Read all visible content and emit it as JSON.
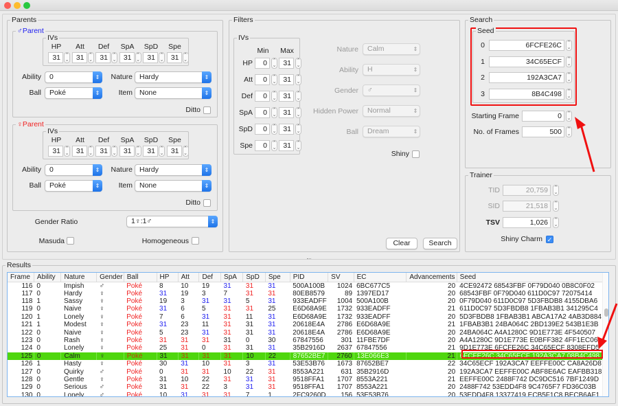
{
  "window": {
    "controls": [
      "close",
      "minimize",
      "maximize"
    ]
  },
  "parents": {
    "title": "Parents",
    "iv_group_label": "IVs",
    "iv_headers": [
      "HP",
      "Att",
      "Def",
      "SpA",
      "SpD",
      "Spe"
    ],
    "male": {
      "title": "♂Parent",
      "ivs": [
        "31",
        "31",
        "31",
        "31",
        "31",
        "31"
      ],
      "ability_label": "Ability",
      "ability": "0",
      "nature_label": "Nature",
      "nature": "Hardy",
      "ball_label": "Ball",
      "ball": "Poké",
      "item_label": "Item",
      "item": "None",
      "ditto_label": "Ditto",
      "ditto": false
    },
    "female": {
      "title": "♀Parent",
      "ivs": [
        "31",
        "31",
        "31",
        "31",
        "31",
        "31"
      ],
      "ability_label": "Ability",
      "ability": "0",
      "nature_label": "Nature",
      "nature": "Hardy",
      "ball_label": "Ball",
      "ball": "Poké",
      "item_label": "Item",
      "item": "None",
      "ditto_label": "Ditto",
      "ditto": false
    },
    "gender_ratio_label": "Gender Ratio",
    "gender_ratio": "1♀:1♂",
    "masuda_label": "Masuda",
    "masuda": false,
    "homogeneous_label": "Homogeneous",
    "homogeneous": false
  },
  "filters": {
    "title": "Filters",
    "ivs_title": "IVs",
    "min_label": "Min",
    "max_label": "Max",
    "iv_rows": [
      {
        "stat": "HP",
        "min": "0",
        "max": "31"
      },
      {
        "stat": "Att",
        "min": "0",
        "max": "31"
      },
      {
        "stat": "Def",
        "min": "0",
        "max": "31"
      },
      {
        "stat": "SpA",
        "min": "0",
        "max": "31"
      },
      {
        "stat": "SpD",
        "min": "0",
        "max": "31"
      },
      {
        "stat": "Spe",
        "min": "0",
        "max": "31"
      }
    ],
    "nature_label": "Nature",
    "nature": "Calm",
    "ability_label": "Ability",
    "ability": "H",
    "gender_label": "Gender",
    "gender": "♂",
    "hidden_power_label": "Hidden Power",
    "hidden_power": "Normal",
    "ball_label": "Ball",
    "ball": "Dream",
    "shiny_label": "Shiny",
    "shiny": false,
    "clear_label": "Clear",
    "search_label": "Search"
  },
  "search": {
    "title": "Search",
    "seed_title": "Seed",
    "seeds": [
      {
        "index": "0",
        "value": "6FCFE26C"
      },
      {
        "index": "1",
        "value": "34C65ECF"
      },
      {
        "index": "2",
        "value": "192A3CA7"
      },
      {
        "index": "3",
        "value": "8B4C498"
      }
    ],
    "starting_frame_label": "Starting Frame",
    "starting_frame": "0",
    "frames_label": "No. of Frames",
    "frames": "500"
  },
  "trainer": {
    "title": "Trainer",
    "tid_label": "TID",
    "tid": "20,759",
    "sid_label": "SID",
    "sid": "21,518",
    "tsv_label": "TSV",
    "tsv": "1,026",
    "shiny_charm_label": "Shiny Charm",
    "shiny_charm": true
  },
  "annotation": {
    "highlight_color": "#ff0000"
  },
  "results": {
    "title": "Results",
    "columns": [
      "Frame",
      "Ability",
      "Nature",
      "Gender",
      "Ball",
      "HP",
      "Att",
      "Def",
      "SpA",
      "SpD",
      "Spe",
      "PID",
      "SV",
      "EC",
      "Advancements",
      "Seed"
    ],
    "iv_colors": {
      "31_red": "#f02020",
      "31_blue": "#2020f0"
    },
    "selected_row_index": 9,
    "rows": [
      {
        "frame": "116",
        "ability": "0",
        "nature": "Impish",
        "gender": "♂",
        "ball": "Poké",
        "ivs": [
          [
            "8",
            ""
          ],
          [
            "10",
            ""
          ],
          [
            "19",
            ""
          ],
          [
            "31",
            "blue"
          ],
          [
            "31",
            "red"
          ],
          [
            "31",
            "blue"
          ]
        ],
        "pid": "500A100B",
        "sv": "1024",
        "ec": "6BC677C5",
        "adv": "20",
        "seed": "4CE92472 68543FBF 0F79D040 0B8C0F02"
      },
      {
        "frame": "117",
        "ability": "0",
        "nature": "Hardy",
        "gender": "♀",
        "ball": "Poké",
        "ivs": [
          [
            "31",
            "blue"
          ],
          [
            "19",
            ""
          ],
          [
            "3",
            ""
          ],
          [
            "7",
            ""
          ],
          [
            "31",
            "red"
          ],
          [
            "31",
            "red"
          ]
        ],
        "pid": "80EB8579",
        "sv": "89",
        "ec": "1397ED17",
        "adv": "20",
        "seed": "68543FBF 0F79D040 611D0C97 72075414"
      },
      {
        "frame": "118",
        "ability": "1",
        "nature": "Sassy",
        "gender": "♀",
        "ball": "Poké",
        "ivs": [
          [
            "19",
            ""
          ],
          [
            "3",
            ""
          ],
          [
            "31",
            "blue"
          ],
          [
            "31",
            "blue"
          ],
          [
            "5",
            ""
          ],
          [
            "31",
            "blue"
          ]
        ],
        "pid": "933EADFF",
        "sv": "1004",
        "ec": "500A100B",
        "adv": "20",
        "seed": "0F79D040 611D0C97 5D3FBDB8 4155DBA6"
      },
      {
        "frame": "119",
        "ability": "0",
        "nature": "Naive",
        "gender": "♀",
        "ball": "Poké",
        "ivs": [
          [
            "31",
            "blue"
          ],
          [
            "6",
            ""
          ],
          [
            "5",
            ""
          ],
          [
            "31",
            "red"
          ],
          [
            "31",
            "red"
          ],
          [
            "25",
            ""
          ]
        ],
        "pid": "E6D68A9E",
        "sv": "1732",
        "ec": "933EADFF",
        "adv": "21",
        "seed": "611D0C97 5D3FBDB8 1FBAB3B1 341295C4"
      },
      {
        "frame": "120",
        "ability": "1",
        "nature": "Lonely",
        "gender": "♀",
        "ball": "Poké",
        "ivs": [
          [
            "7",
            ""
          ],
          [
            "6",
            ""
          ],
          [
            "31",
            "blue"
          ],
          [
            "31",
            "red"
          ],
          [
            "11",
            ""
          ],
          [
            "31",
            "blue"
          ]
        ],
        "pid": "E6D68A9E",
        "sv": "1732",
        "ec": "933EADFF",
        "adv": "20",
        "seed": "5D3FBDB8 1FBAB3B1 ABCA17A2 4AB3D884"
      },
      {
        "frame": "121",
        "ability": "1",
        "nature": "Modest",
        "gender": "♀",
        "ball": "Poké",
        "ivs": [
          [
            "31",
            "blue"
          ],
          [
            "23",
            ""
          ],
          [
            "11",
            ""
          ],
          [
            "31",
            "red"
          ],
          [
            "31",
            ""
          ],
          [
            "31",
            "blue"
          ]
        ],
        "pid": "20618E4A",
        "sv": "2786",
        "ec": "E6D68A9E",
        "adv": "21",
        "seed": "1FBAB3B1 24BA064C 2BD139E2 543B1E3B"
      },
      {
        "frame": "122",
        "ability": "0",
        "nature": "Naive",
        "gender": "♀",
        "ball": "Poké",
        "ivs": [
          [
            "5",
            ""
          ],
          [
            "23",
            ""
          ],
          [
            "31",
            "blue"
          ],
          [
            "31",
            "red"
          ],
          [
            "31",
            ""
          ],
          [
            "31",
            "blue"
          ]
        ],
        "pid": "20618E4A",
        "sv": "2786",
        "ec": "E6D68A9E",
        "adv": "20",
        "seed": "24BA064C A4A1280C 9D1E773E 4F540507"
      },
      {
        "frame": "123",
        "ability": "0",
        "nature": "Rash",
        "gender": "♀",
        "ball": "Poké",
        "ivs": [
          [
            "31",
            "red"
          ],
          [
            "31",
            "red"
          ],
          [
            "31",
            "red"
          ],
          [
            "31",
            ""
          ],
          [
            "0",
            ""
          ],
          [
            "30",
            ""
          ]
        ],
        "pid": "67847556",
        "sv": "301",
        "ec": "11FBE7DF",
        "adv": "20",
        "seed": "A4A1280C 9D1E773E E0BFF382 4FF1EC06"
      },
      {
        "frame": "124",
        "ability": "0",
        "nature": "Lonely",
        "gender": "♀",
        "ball": "Poké",
        "ivs": [
          [
            "25",
            ""
          ],
          [
            "31",
            "red"
          ],
          [
            "0",
            ""
          ],
          [
            "31",
            "red"
          ],
          [
            "31",
            ""
          ],
          [
            "31",
            "blue"
          ]
        ],
        "pid": "35B2916D",
        "sv": "2637",
        "ec": "67847556",
        "adv": "21",
        "seed": "9D1E773E 6FCFE26C 34C65ECF 8308EFD5"
      },
      {
        "frame": "125",
        "ability": "0",
        "nature": "Calm",
        "gender": "♀",
        "ball": "Poké",
        "ivs": [
          [
            "31",
            ""
          ],
          [
            "31",
            "red"
          ],
          [
            "31",
            "red"
          ],
          [
            "31",
            "red"
          ],
          [
            "10",
            ""
          ],
          [
            "22",
            ""
          ]
        ],
        "pid": "87652BE7",
        "sv": "2760",
        "ec": "13E066E3",
        "adv": "21",
        "seed": "6FCFE26C 34C65ECF 192A3CA7 08B4C498"
      },
      {
        "frame": "126",
        "ability": "1",
        "nature": "Hasty",
        "gender": "♀",
        "ball": "Poké",
        "ivs": [
          [
            "30",
            ""
          ],
          [
            "31",
            "blue"
          ],
          [
            "10",
            ""
          ],
          [
            "31",
            "red"
          ],
          [
            "3",
            ""
          ],
          [
            "31",
            "blue"
          ]
        ],
        "pid": "53E53B76",
        "sv": "1673",
        "ec": "87652BE7",
        "adv": "22",
        "seed": "34C65ECF 192A3CA7 EEFFE00C CA8A26D8"
      },
      {
        "frame": "127",
        "ability": "0",
        "nature": "Quirky",
        "gender": "♂",
        "ball": "Poké",
        "ivs": [
          [
            "0",
            ""
          ],
          [
            "31",
            "red"
          ],
          [
            "31",
            "red"
          ],
          [
            "10",
            ""
          ],
          [
            "22",
            ""
          ],
          [
            "31",
            "red"
          ]
        ],
        "pid": "8553A221",
        "sv": "631",
        "ec": "35B2916D",
        "adv": "20",
        "seed": "192A3CA7 EEFFE00C ABF8E6AC EAFBB318"
      },
      {
        "frame": "128",
        "ability": "0",
        "nature": "Gentle",
        "gender": "♀",
        "ball": "Poké",
        "ivs": [
          [
            "31",
            ""
          ],
          [
            "10",
            ""
          ],
          [
            "22",
            ""
          ],
          [
            "31",
            "red"
          ],
          [
            "31",
            "blue"
          ],
          [
            "31",
            "red"
          ]
        ],
        "pid": "9518FFA1",
        "sv": "1707",
        "ec": "8553A221",
        "adv": "21",
        "seed": "EEFFE00C 2488F742 DC9DC516 7BF1249D"
      },
      {
        "frame": "129",
        "ability": "0",
        "nature": "Serious",
        "gender": "♂",
        "ball": "Poké",
        "ivs": [
          [
            "31",
            ""
          ],
          [
            "31",
            "red"
          ],
          [
            "22",
            ""
          ],
          [
            "3",
            ""
          ],
          [
            "31",
            "blue"
          ],
          [
            "31",
            "red"
          ]
        ],
        "pid": "9518FFA1",
        "sv": "1707",
        "ec": "8553A221",
        "adv": "20",
        "seed": "2488F742 53EDD4F8 9C4765F7 FD36C03B"
      },
      {
        "frame": "130",
        "ability": "0",
        "nature": "Lonely",
        "gender": "♂",
        "ball": "Poké",
        "ivs": [
          [
            "10",
            ""
          ],
          [
            "31",
            "blue"
          ],
          [
            "31",
            "red"
          ],
          [
            "31",
            "red"
          ],
          [
            "7",
            ""
          ],
          [
            "1",
            ""
          ]
        ],
        "pid": "2FC9260D",
        "sv": "156",
        "ec": "53E53B76",
        "adv": "20",
        "seed": "53EDD4F8 13377419 ECB5F1C8 BECB6AF1"
      }
    ]
  }
}
